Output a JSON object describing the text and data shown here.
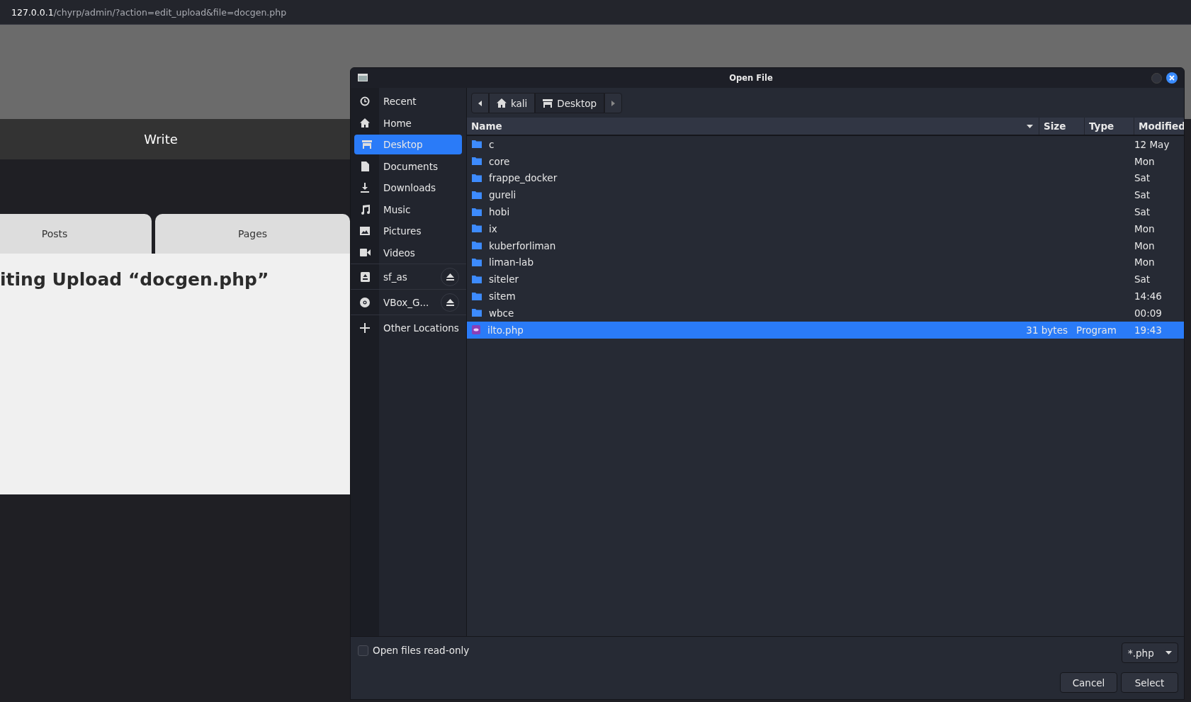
{
  "browser": {
    "url": {
      "host": "127.0.0.1",
      "path": "/chyrp/admin/?action=edit_upload&file=docgen.php"
    }
  },
  "site": {
    "nav": [
      {
        "label": "Write"
      }
    ],
    "tabs": [
      {
        "label": "Posts",
        "selected": false
      },
      {
        "label": "Pages",
        "selected": false
      }
    ],
    "heading": "iting Upload “docgen.php”"
  },
  "dialog": {
    "title": "Open File",
    "path": [
      {
        "label": "kali",
        "kind": "home",
        "selected": false
      },
      {
        "label": "Desktop",
        "kind": "desktop",
        "selected": true
      }
    ],
    "places": [
      {
        "label": "Recent",
        "kind": "recent",
        "selected": false
      },
      {
        "label": "Home",
        "kind": "home",
        "selected": false
      },
      {
        "label": "Desktop",
        "kind": "desktop",
        "selected": true
      },
      {
        "label": "Documents",
        "kind": "documents",
        "selected": false
      },
      {
        "label": "Downloads",
        "kind": "downloads",
        "selected": false
      },
      {
        "label": "Music",
        "kind": "music",
        "selected": false
      },
      {
        "label": "Pictures",
        "kind": "pictures",
        "selected": false
      },
      {
        "label": "Videos",
        "kind": "videos",
        "selected": false
      },
      {
        "label": "sf_as",
        "kind": "drive",
        "selected": false,
        "eject": true
      },
      {
        "label": "VBox_G...",
        "kind": "disc",
        "selected": false,
        "eject": true
      },
      {
        "label": "Other Locations",
        "kind": "other",
        "selected": false
      }
    ],
    "columns": [
      "Name",
      "Size",
      "Type",
      "Modified"
    ],
    "files": [
      {
        "name": "c",
        "kind": "folder",
        "modified": "12 May",
        "selected": false
      },
      {
        "name": "core",
        "kind": "folder",
        "modified": "Mon",
        "selected": false
      },
      {
        "name": "frappe_docker",
        "kind": "folder",
        "modified": "Sat",
        "selected": false
      },
      {
        "name": "gureli",
        "kind": "folder",
        "modified": "Sat",
        "selected": false
      },
      {
        "name": "hobi",
        "kind": "folder",
        "modified": "Sat",
        "selected": false
      },
      {
        "name": "ix",
        "kind": "folder",
        "modified": "Mon",
        "selected": false
      },
      {
        "name": "kuberforliman",
        "kind": "folder",
        "modified": "Mon",
        "selected": false
      },
      {
        "name": "liman-lab",
        "kind": "folder",
        "modified": "Mon",
        "selected": false
      },
      {
        "name": "siteler",
        "kind": "folder",
        "modified": "Sat",
        "selected": false
      },
      {
        "name": "sitem",
        "kind": "folder",
        "modified": "14:46",
        "selected": false
      },
      {
        "name": "wbce",
        "kind": "folder",
        "modified": "00:09",
        "selected": false
      },
      {
        "name": "ilto.php",
        "kind": "program",
        "size": "31 bytes",
        "type": "Program",
        "modified": "19:43",
        "selected": true
      }
    ],
    "read_only": {
      "label": "Open files read-only",
      "checked": false
    },
    "filter": "*.php",
    "buttons": [
      "Cancel",
      "Select"
    ]
  }
}
